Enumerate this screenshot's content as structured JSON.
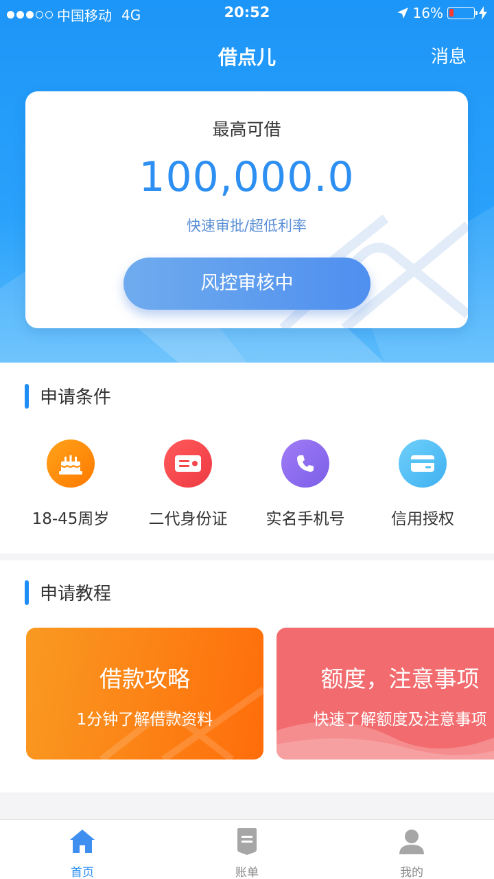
{
  "status_bar": {
    "carrier": "中国移动",
    "network": "4G",
    "time": "20:52",
    "battery": "16%",
    "signal_bars": 3
  },
  "nav": {
    "title": "借点儿",
    "message": "消息"
  },
  "card": {
    "label": "最高可借",
    "amount": "100,000.0",
    "subtitle": "快速审批/超低利率",
    "button": "风控审核中"
  },
  "conditions": {
    "title": "申请条件",
    "items": [
      {
        "label": "18-45周岁",
        "icon": "cake-icon",
        "color": "#ff8a00"
      },
      {
        "label": "二代身份证",
        "icon": "id-card-icon",
        "color": "#f4474d"
      },
      {
        "label": "实名手机号",
        "icon": "phone-icon",
        "color": "#8b6cf0"
      },
      {
        "label": "信用授权",
        "icon": "credit-card-icon",
        "color": "#55c1f5"
      }
    ]
  },
  "tutorials": {
    "title": "申请教程",
    "items": [
      {
        "title": "借款攻略",
        "subtitle": "1分钟了解借款资料",
        "color": "#ff7a10"
      },
      {
        "title": "额度，注意事项",
        "subtitle": "快速了解额度及注意事项",
        "color": "#f26c6f"
      }
    ]
  },
  "tabbar": {
    "tabs": [
      {
        "label": "首页",
        "icon": "home-icon",
        "active": true
      },
      {
        "label": "账单",
        "icon": "bill-icon",
        "active": false
      },
      {
        "label": "我的",
        "icon": "user-icon",
        "active": false
      }
    ],
    "accent": "#2d8ff2"
  }
}
